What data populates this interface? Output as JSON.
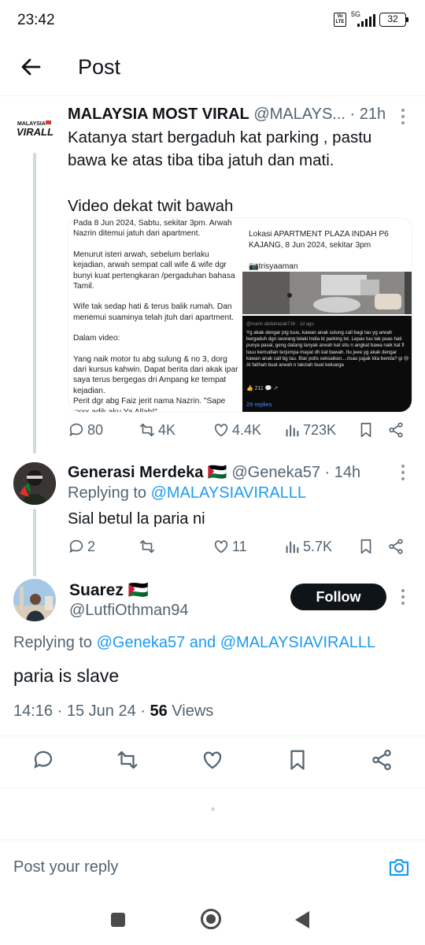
{
  "status_bar": {
    "time": "23:42",
    "network": "5G",
    "volte": "Vo LTE",
    "battery": "32"
  },
  "header": {
    "title": "Post"
  },
  "parent_post": {
    "author_name": "MALAYSIA MOST VIRAL",
    "handle": "@MALAYS...",
    "separator": "·",
    "time": "21h",
    "avatar_text": "MALAYSIA VIRALL",
    "text_line1": "Katanya start bergaduh kat parking , pastu",
    "text_line2": "bawa ke atas tiba tiba jatuh dan mati.",
    "text_line3": "Video dekat twit bawah",
    "media": {
      "left_text": [
        "Pada 8 Jun 2024, Sabtu, sekitar 3pm. Arwah Nazrin ditemui jatuh dari apartment.",
        "Menurut isteri arwah, sebelum berlaku kejadian, arwah sempat call wife & wife dgr bunyi kuat pertengkaran /pergaduhan bahasa Tamil.",
        "Wife tak sedap hati & terus balik rumah. Dan menemui suaminya telah jtuh dari apartment.",
        "Dalam video:",
        "Yang naik motor tu abg sulung & no 3, dorg dari kursus kahwin. Dapat berita dari akak ipar saya terus bergegas dri Ampang ke tempat kejadian.",
        "Perit dgr abg Faiz jerit nama Nazrin. \"Sape xxxx adik aku Ya Allah!\""
      ],
      "right_head": "Lokasi APARTMENT PLAZA INDAH P6 KAJANG, 8 Jun 2024, sekitar 3pm",
      "right_handle": "📷trisyaaman",
      "dark_head": "@marin abdulrazak716 · 1d ago",
      "dark_text": "Yg akak dengar ptg tuuu, kawan anak sulung call bagi tau yg arwah bergaduh dgn seorang lelaki India kt parking lot. Lepas tuu tak puas hati punya pasal, geng datang lanyak arwah kat situ n angkat bawa naik kat fl tuuu kemudian terjumpa mayat dh kat bawah. Itu jeee yg akak dengar kawan anak call bg tau. Biar polis seksaikan....risau jugak kita benda? gi 😢Al fatihah buat arwah n takziah buat keluarga",
      "dark_meta": "👍 211   💬   ↗",
      "dark_replies": "29 replies"
    },
    "stats": {
      "replies": "80",
      "reposts": "4K",
      "likes": "4.4K",
      "views": "723K"
    }
  },
  "reply_post": {
    "author_name": "Generasi Merdeka",
    "flag": "🇵🇸",
    "handle": "@Geneka57",
    "separator": "·",
    "time": "14h",
    "replying_prefix": "Replying to",
    "replying_to": "@MALAYSIAVIRALLL",
    "text": "Sial betul la paria ni",
    "stats": {
      "replies": "2",
      "reposts": "",
      "likes": "11",
      "views": "5.7K"
    }
  },
  "focus_post": {
    "author_name": "Suarez",
    "flag": "🇵🇸",
    "handle": "@LutfiOthman94",
    "follow_label": "Follow",
    "replying_prefix": "Replying to",
    "replying_to_1": "@Geneka57",
    "replying_and": "and",
    "replying_to_2": "@MALAYSIAVIRALLL",
    "text": "paria is slave",
    "time": "14:16",
    "date": "15 Jun 24",
    "views_count": "56",
    "views_label": "Views"
  },
  "reply_bar": {
    "placeholder": "Post your reply"
  },
  "colors": {
    "accent": "#1d9bf0",
    "text": "#0f1419",
    "muted": "#536471",
    "follow_bg": "#0f1419"
  }
}
